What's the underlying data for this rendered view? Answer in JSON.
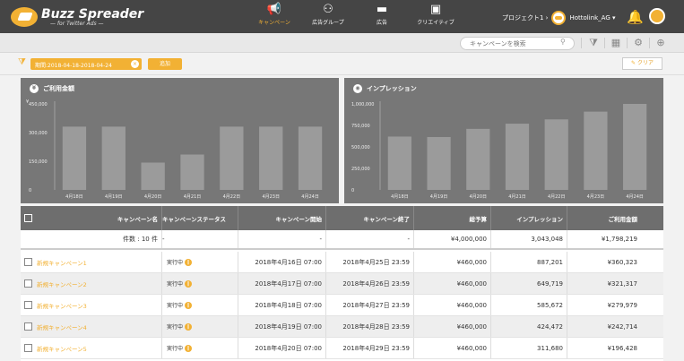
{
  "app": {
    "logo_main": "Buzz Spreader",
    "logo_sub": "— for Twitter Ads —"
  },
  "nav": [
    {
      "label": "キャンペーン",
      "icon": "megaphone-icon",
      "glyph": "📢",
      "active": true
    },
    {
      "label": "広告グループ",
      "icon": "group-icon",
      "glyph": "⚇",
      "active": false
    },
    {
      "label": "広告",
      "icon": "ad-icon",
      "glyph": "▬",
      "active": false
    },
    {
      "label": "クリエイティブ",
      "icon": "image-icon",
      "glyph": "▣",
      "active": false
    }
  ],
  "project": {
    "label": "プロジェクト1 ›",
    "account": "Hottolink_AG ▾"
  },
  "toolbar": {
    "search_placeholder": "キャンペーンを検索",
    "search_icon": "magnifier-icon"
  },
  "filter": {
    "date_chip": "期間:2018-04-18-2018-04-24",
    "chip_close": "×",
    "add_label": "追加",
    "clear_label": "クリア",
    "funnel_glyph": "⧩"
  },
  "colors": {
    "accent": "#f2b134",
    "header_bg": "#454545",
    "chart_bg": "#777777",
    "bar": "#9b9b9b"
  },
  "charts": [
    {
      "title": "ご利用金額",
      "icon": "yen-icon",
      "icon_glyph": "¥",
      "chart_data": {
        "type": "bar",
        "categories": [
          "4月18日",
          "4月19日",
          "4月20日",
          "4月21日",
          "4月22日",
          "4月23日",
          "4月24日"
        ],
        "values": [
          331000,
          331000,
          143000,
          185000,
          331000,
          331000,
          331000
        ],
        "ylim": [
          0,
          450000
        ],
        "yticks": [
          {
            "v": 450000,
            "label": "450,000"
          },
          {
            "v": 300000,
            "label": "300,000"
          },
          {
            "v": 150000,
            "label": "150,000"
          },
          {
            "v": 0,
            "label": "0"
          }
        ],
        "ylabel": "¥",
        "grid": false
      }
    },
    {
      "title": "インプレッション",
      "icon": "eye-icon",
      "icon_glyph": "◉",
      "chart_data": {
        "type": "bar",
        "categories": [
          "4月18日",
          "4月19日",
          "4月20日",
          "4月21日",
          "4月22日",
          "4月23日",
          "4月24日"
        ],
        "values": [
          620000,
          615000,
          710000,
          770000,
          820000,
          910000,
          1000000
        ],
        "ylim": [
          0,
          1000000
        ],
        "yticks": [
          {
            "v": 1000000,
            "label": "1,000,000"
          },
          {
            "v": 750000,
            "label": "750,000"
          },
          {
            "v": 500000,
            "label": "500,000"
          },
          {
            "v": 250000,
            "label": "250,000"
          },
          {
            "v": 0,
            "label": "0"
          }
        ],
        "ylabel": "",
        "grid": false
      }
    }
  ],
  "table": {
    "headers": [
      "キャンペーン名",
      "キャンペーンステータス",
      "キャンペーン開始",
      "キャンペーン終了",
      "総予算",
      "インプレッション",
      "ご利用金額"
    ],
    "total": {
      "name": "件数 : 10 件",
      "status": "-",
      "start": "-",
      "end": "-",
      "budget": "¥4,000,000",
      "impressions": "3,043,048",
      "spend": "¥1,798,219"
    },
    "rows": [
      {
        "name": "新規キャンペーン1",
        "status": "実行中",
        "start": "2018年4月16日 07:00",
        "end": "2018年4月25日 23:59",
        "budget": "¥460,000",
        "impressions": "887,201",
        "spend": "¥360,323"
      },
      {
        "name": "新規キャンペーン2",
        "status": "実行中",
        "start": "2018年4月17日 07:00",
        "end": "2018年4月26日 23:59",
        "budget": "¥460,000",
        "impressions": "649,719",
        "spend": "¥321,317"
      },
      {
        "name": "新規キャンペーン3",
        "status": "実行中",
        "start": "2018年4月18日 07:00",
        "end": "2018年4月27日 23:59",
        "budget": "¥460,000",
        "impressions": "585,672",
        "spend": "¥279,979"
      },
      {
        "name": "新規キャンペーン4",
        "status": "実行中",
        "start": "2018年4月19日 07:00",
        "end": "2018年4月28日 23:59",
        "budget": "¥460,000",
        "impressions": "424,472",
        "spend": "¥242,714"
      },
      {
        "name": "新規キャンペーン5",
        "status": "実行中",
        "start": "2018年4月20日 07:00",
        "end": "2018年4月29日 23:59",
        "budget": "¥460,000",
        "impressions": "311,680",
        "spend": "¥196,428"
      }
    ]
  }
}
